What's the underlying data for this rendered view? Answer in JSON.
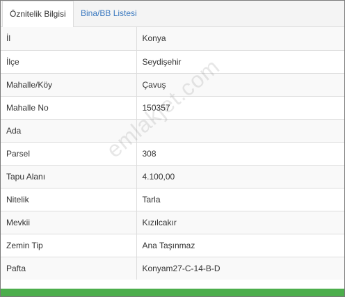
{
  "tabs": [
    {
      "label": "Öznitelik Bilgisi",
      "active": true
    },
    {
      "label": "Bina/BB Listesi",
      "active": false
    }
  ],
  "rows": [
    {
      "label": "İl",
      "value": "Konya"
    },
    {
      "label": "İlçe",
      "value": "Seydişehir"
    },
    {
      "label": "Mahalle/Köy",
      "value": "Çavuş"
    },
    {
      "label": "Mahalle No",
      "value": "150357"
    },
    {
      "label": "Ada",
      "value": ""
    },
    {
      "label": "Parsel",
      "value": "308"
    },
    {
      "label": "Tapu Alanı",
      "value": "4.100,00"
    },
    {
      "label": "Nitelik",
      "value": "Tarla"
    },
    {
      "label": "Mevkii",
      "value": "Kızılcakır"
    },
    {
      "label": "Zemin Tip",
      "value": "Ana Taşınmaz"
    },
    {
      "label": "Pafta",
      "value": "Konyam27-C-14-B-D"
    }
  ],
  "watermark": "emlakjet.com",
  "colors": {
    "tab_link": "#3c7ac0",
    "bottom_bar": "#4cae4c",
    "stripe": "#f9f9f9"
  }
}
